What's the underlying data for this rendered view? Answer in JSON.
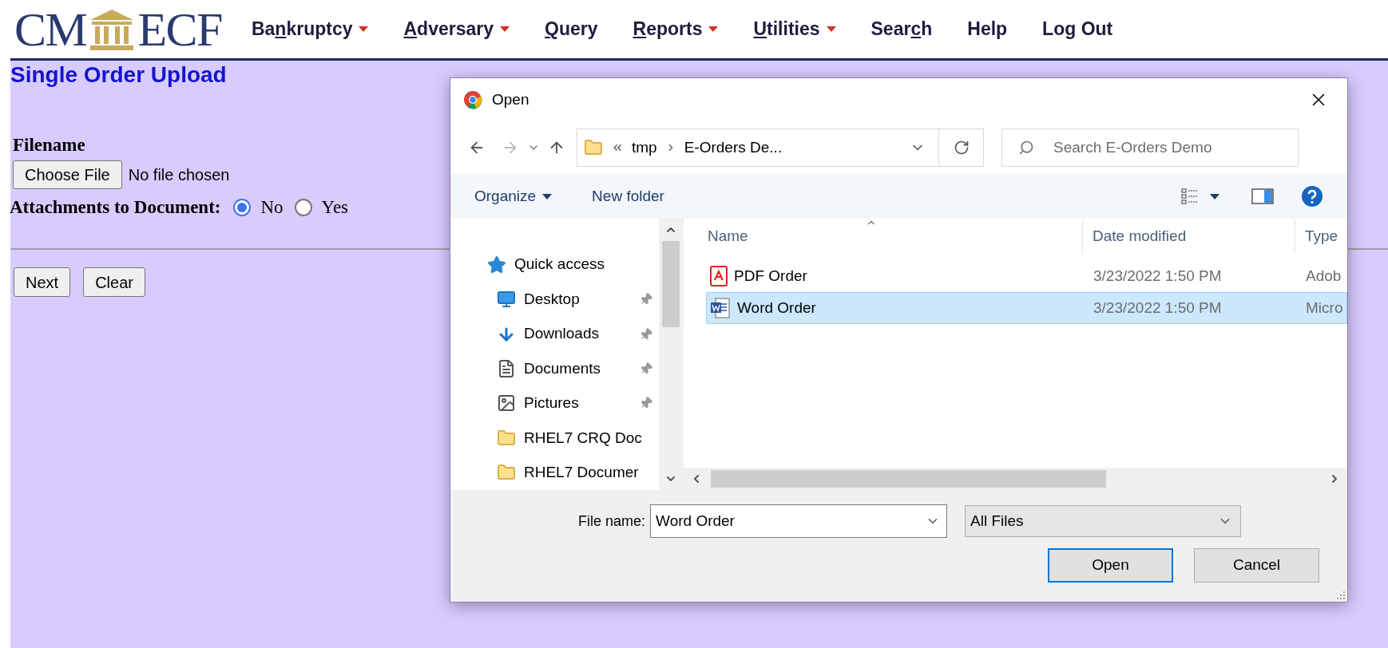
{
  "logo": {
    "left": "CM",
    "right": "ECF"
  },
  "menu": [
    {
      "before": "Ba",
      "access_key": "n",
      "after": "kruptcy",
      "has_menu": true
    },
    {
      "access_key": "A",
      "after": "dversary",
      "has_menu": true
    },
    {
      "access_key": "Q",
      "after": "uery",
      "has_menu": false
    },
    {
      "access_key": "R",
      "after": "eports",
      "has_menu": true
    },
    {
      "access_key": "U",
      "after": "tilities",
      "has_menu": true
    },
    {
      "before": "Sear",
      "access_key": "c",
      "after": "h",
      "has_menu": false
    },
    {
      "label": "Help",
      "has_menu": false
    },
    {
      "label": "Log Out",
      "has_menu": false
    }
  ],
  "page": {
    "title": "Single Order Upload",
    "filename_label": "Filename",
    "choose_button": "Choose File",
    "file_status": "No file chosen",
    "attachments_label": "Attachments to Document:",
    "attachments": [
      {
        "label": "No",
        "selected": true
      },
      {
        "label": "Yes",
        "selected": false
      }
    ],
    "buttons": [
      "Next",
      "Clear"
    ]
  },
  "dialog": {
    "title": "Open",
    "path": [
      "tmp",
      "E-Orders De..."
    ],
    "search": {
      "placeholder": "Search E-Orders Demo"
    },
    "toolbar": {
      "organize": "Organize",
      "new_folder": "New folder"
    },
    "nav_pane": [
      {
        "label": "Quick access",
        "kind": "star",
        "pinned": false
      },
      {
        "label": "Desktop",
        "kind": "desktop",
        "pinned": true
      },
      {
        "label": "Downloads",
        "kind": "downloads",
        "pinned": true
      },
      {
        "label": "Documents",
        "kind": "documents",
        "pinned": true
      },
      {
        "label": "Pictures",
        "kind": "pictures",
        "pinned": true
      },
      {
        "label": "RHEL7 CRQ Doc",
        "kind": "folder",
        "pinned": false
      },
      {
        "label": "RHEL7 Documer",
        "kind": "folder",
        "pinned": false
      }
    ],
    "columns": [
      "Name",
      "Date modified",
      "Type"
    ],
    "files": [
      {
        "name": "PDF Order",
        "kind": "pdf",
        "date": "3/23/2022 1:50 PM",
        "type": "Adob",
        "selected": false
      },
      {
        "name": "Word Order",
        "kind": "word",
        "date": "3/23/2022 1:50 PM",
        "type": "Micro",
        "selected": true
      }
    ],
    "file_name_label": "File name:",
    "file_name": "Word Order",
    "filter": "All Files",
    "buttons": [
      "Open",
      "Cancel"
    ]
  }
}
